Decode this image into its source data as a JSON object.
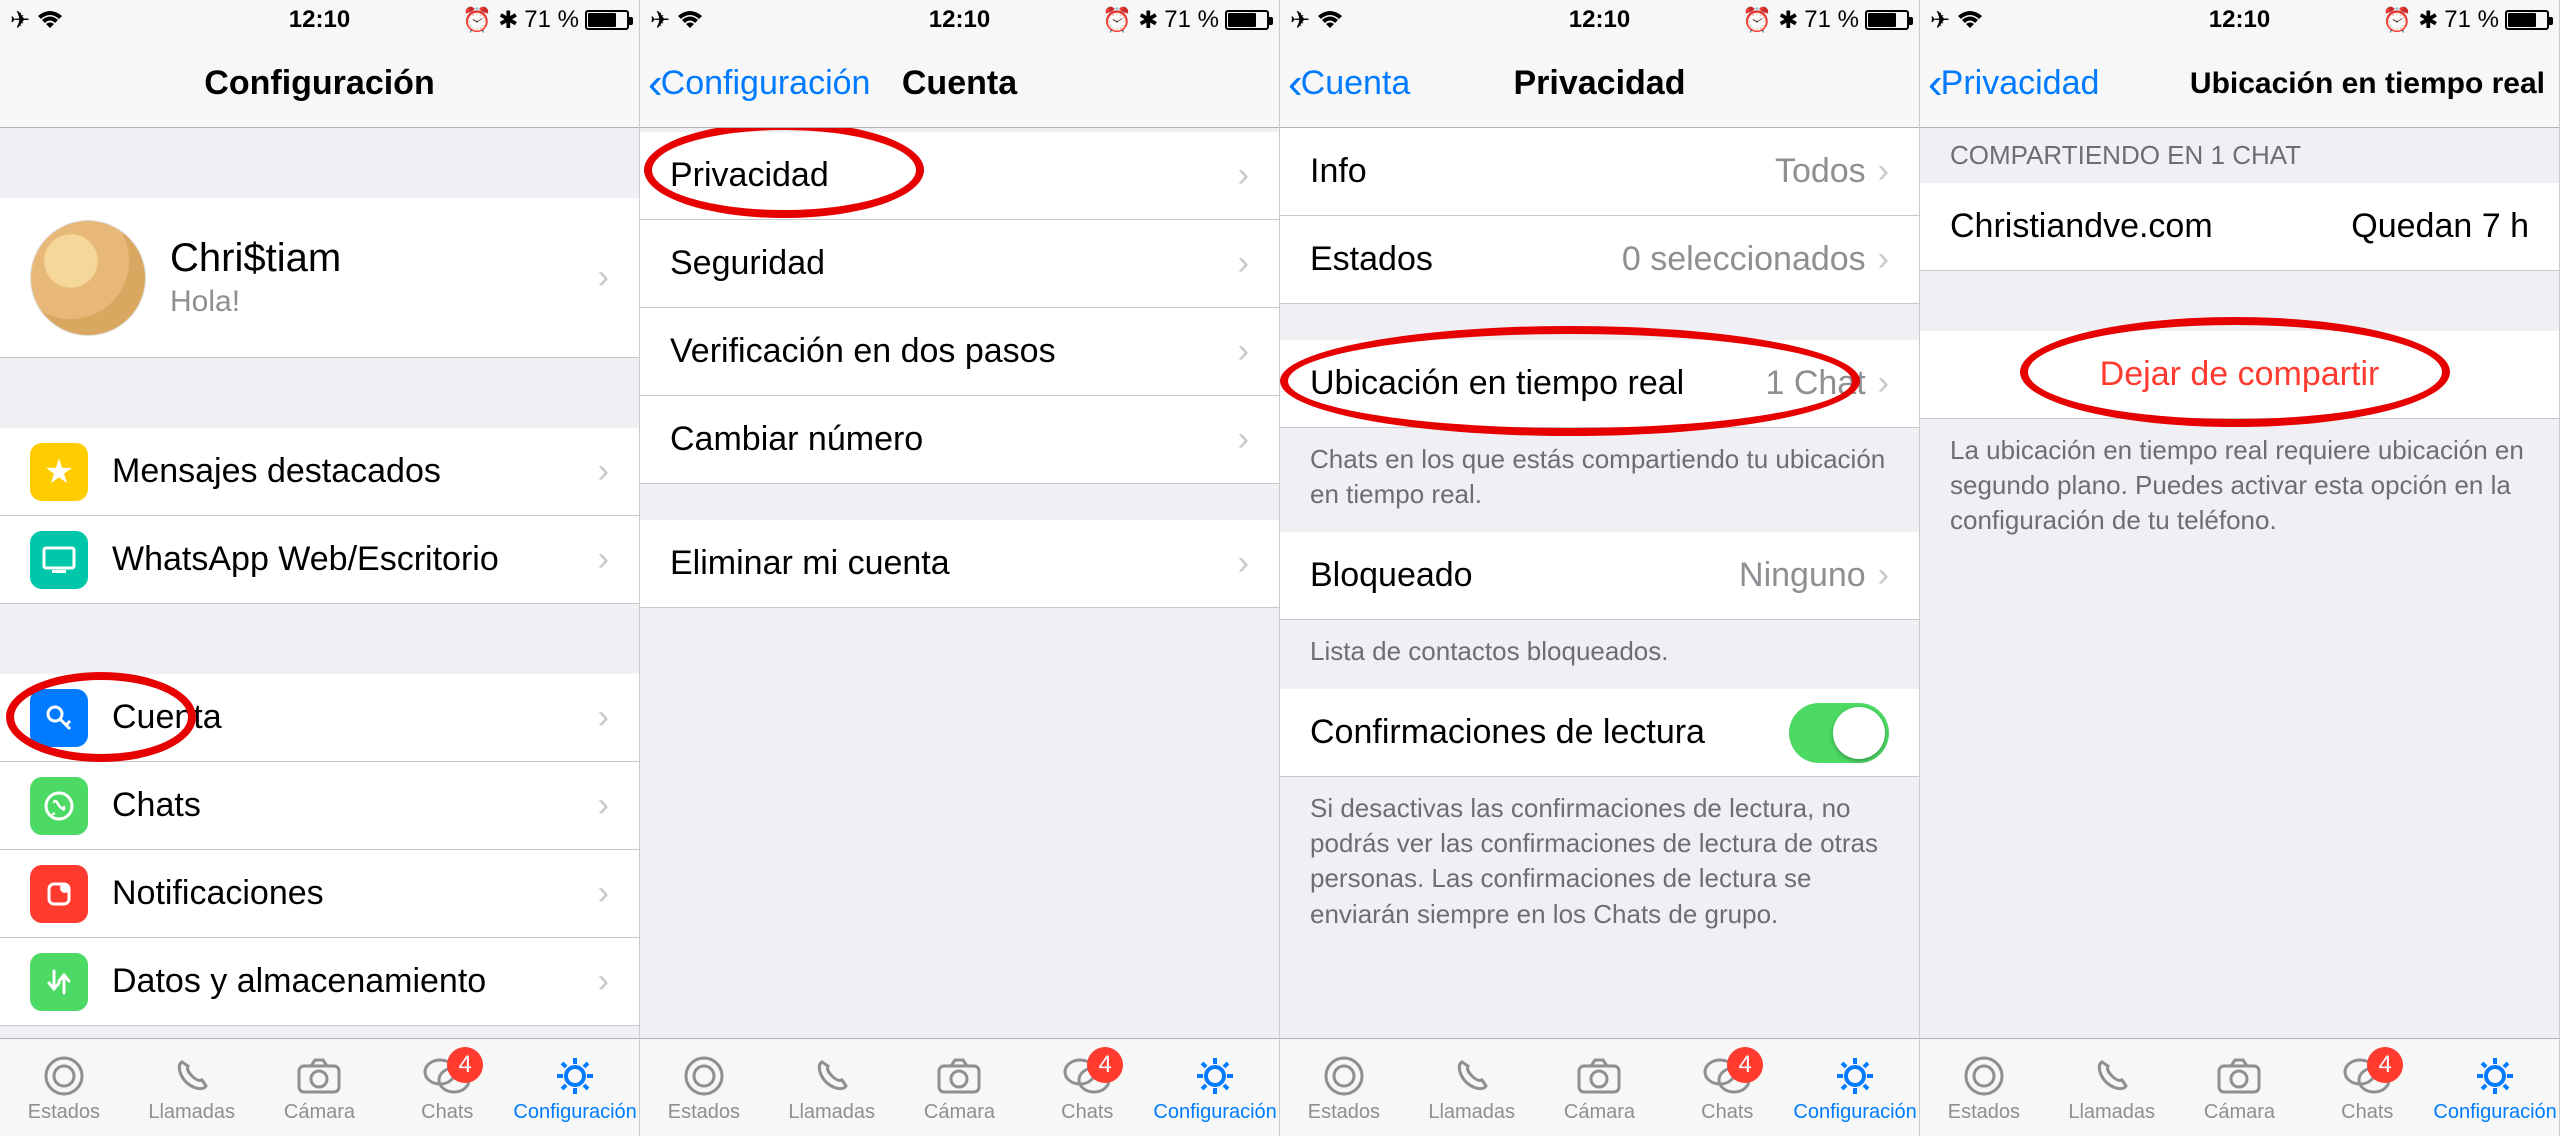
{
  "status": {
    "time": "12:10",
    "battery": "71 %"
  },
  "tabs": {
    "items": [
      {
        "label": "Estados"
      },
      {
        "label": "Llamadas"
      },
      {
        "label": "Cámara"
      },
      {
        "label": "Chats",
        "badge": "4"
      },
      {
        "label": "Configuración"
      }
    ]
  },
  "screen1": {
    "title": "Configuración",
    "profile": {
      "name": "Chri$tiam",
      "status": "Hola!"
    },
    "rows": {
      "starred": "Mensajes destacados",
      "web": "WhatsApp Web/Escritorio",
      "account": "Cuenta",
      "chats": "Chats",
      "notifications": "Notificaciones",
      "data": "Datos y almacenamiento"
    }
  },
  "screen2": {
    "back": "Configuración",
    "title": "Cuenta",
    "rows": {
      "privacy": "Privacidad",
      "security": "Seguridad",
      "twostep": "Verificación en dos pasos",
      "change": "Cambiar número",
      "delete": "Eliminar mi cuenta"
    }
  },
  "screen3": {
    "back": "Cuenta",
    "title": "Privacidad",
    "rows": {
      "info": {
        "label": "Info",
        "value": "Todos"
      },
      "states": {
        "label": "Estados",
        "value": "0 seleccionados"
      },
      "live": {
        "label": "Ubicación en tiempo real",
        "value": "1 Chat"
      },
      "live_footer": "Chats en los que estás compartiendo tu ubicación en tiempo real.",
      "blocked": {
        "label": "Bloqueado",
        "value": "Ninguno"
      },
      "blocked_footer": "Lista de contactos bloqueados.",
      "read": "Confirmaciones de lectura",
      "read_footer": "Si desactivas las confirmaciones de lectura, no podrás ver las confirmaciones de lectura de otras personas. Las confirmaciones de lectura se enviarán siempre en los Chats de grupo."
    }
  },
  "screen4": {
    "back": "Privacidad",
    "title": "Ubicación en tiempo real",
    "header": "COMPARTIENDO EN 1 CHAT",
    "row": {
      "label": "Christiandve.com",
      "value": "Quedan 7 h"
    },
    "stop": "Dejar de compartir",
    "footer": "La ubicación en tiempo real requiere ubicación en segundo plano. Puedes activar esta opción en la configuración de tu teléfono."
  }
}
